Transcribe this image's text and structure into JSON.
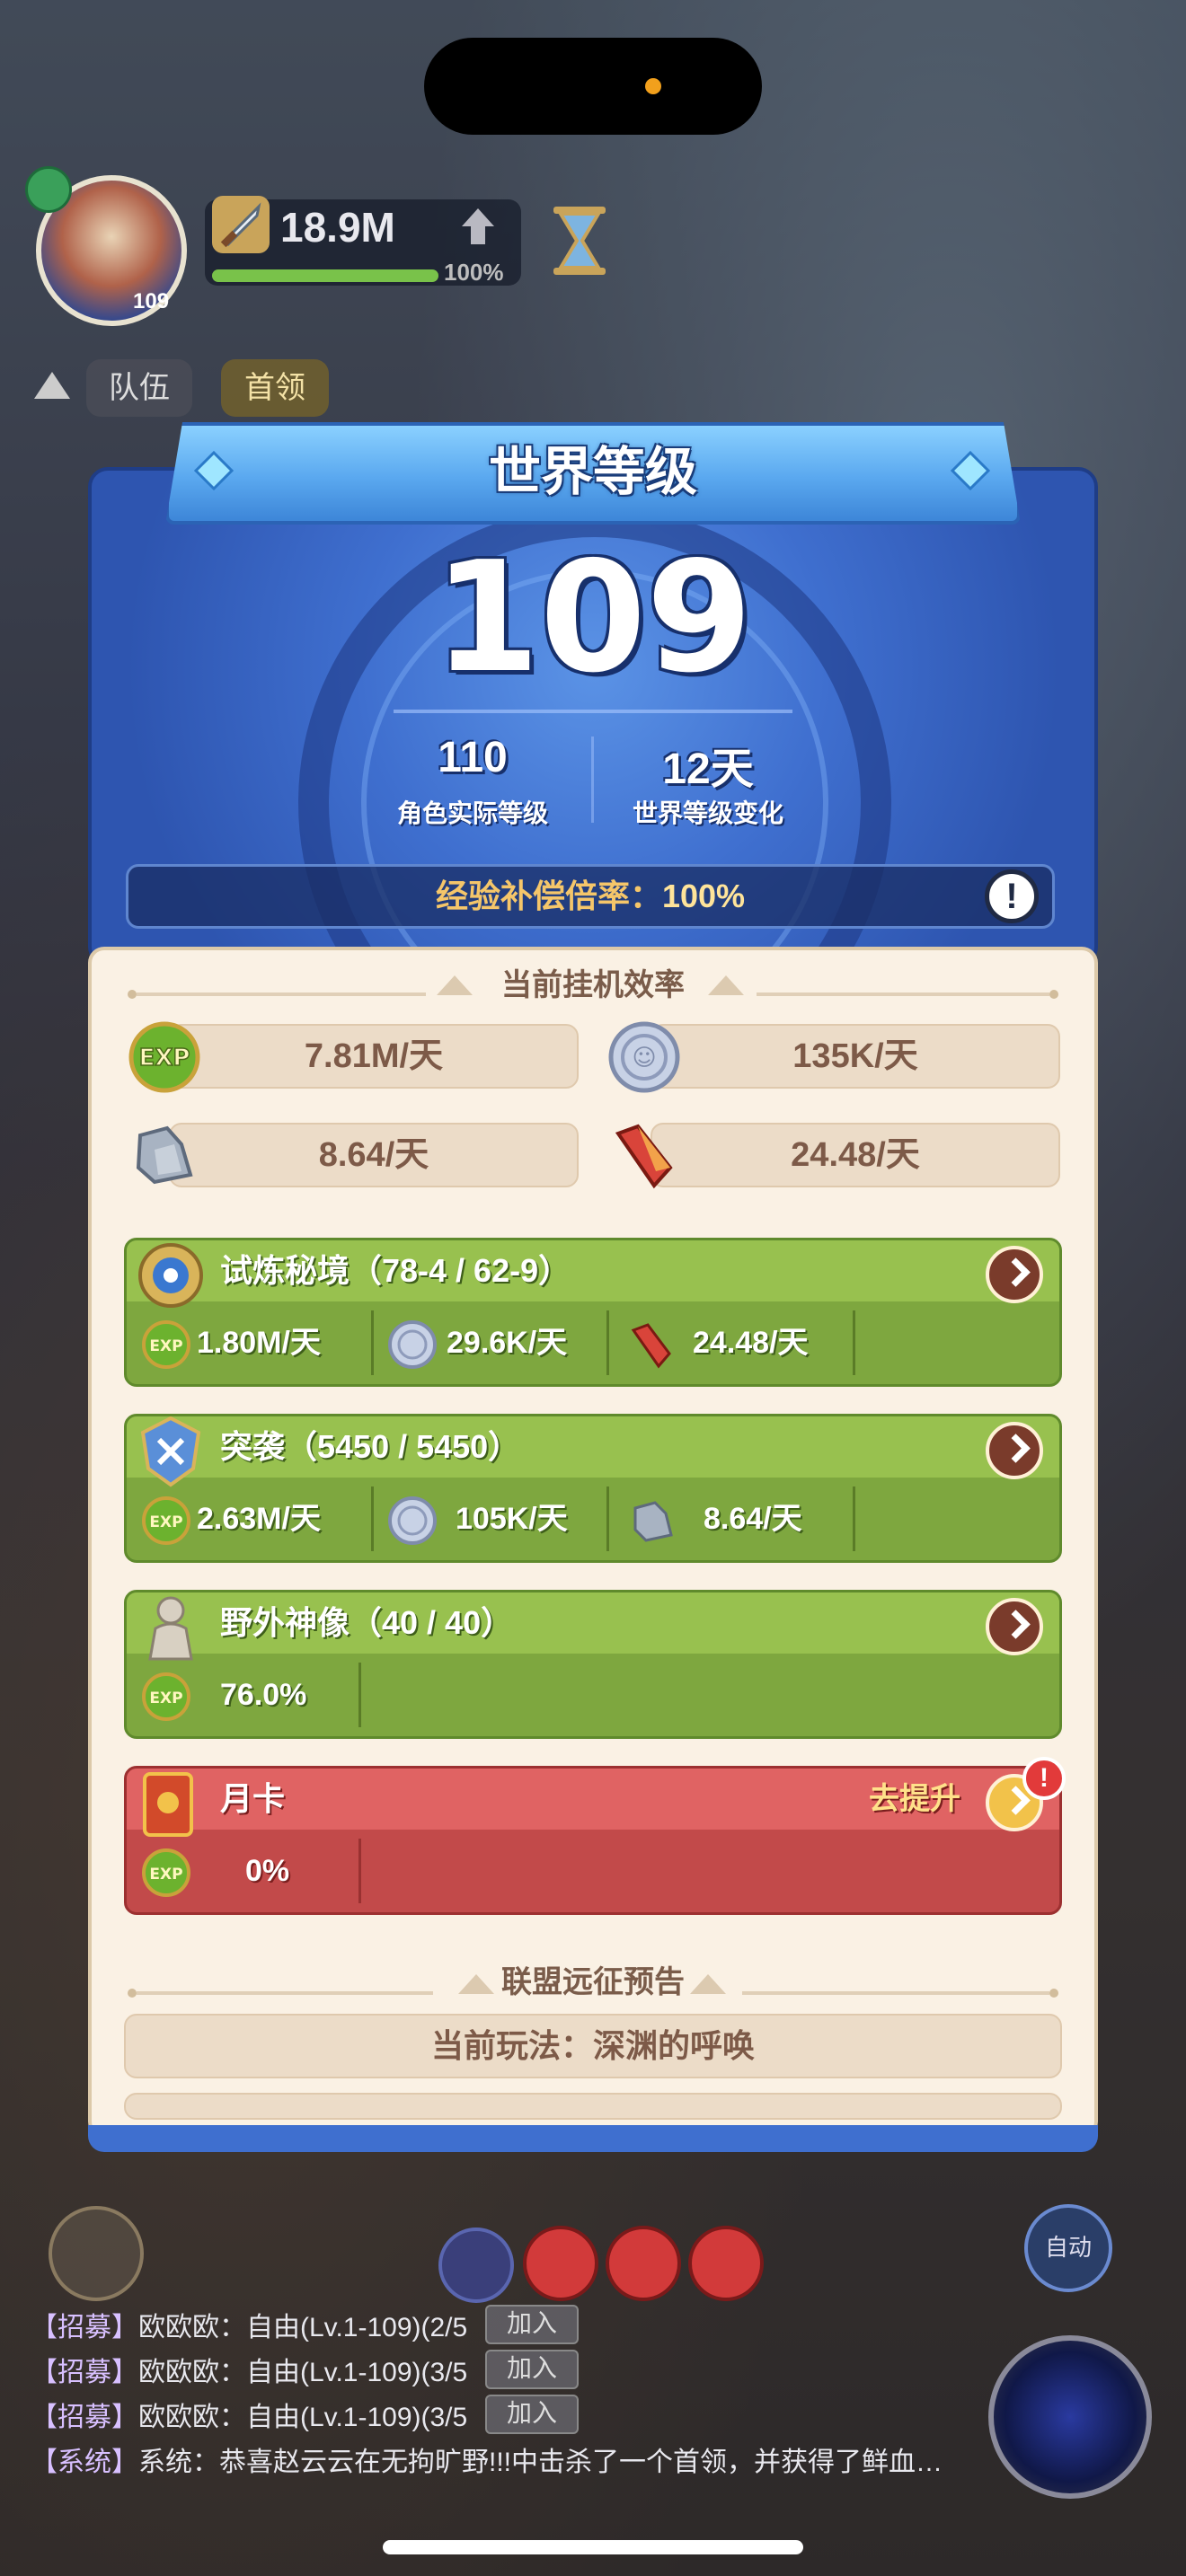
{
  "hud": {
    "avatar_level": "109",
    "power": "18.9M",
    "progress_pct": "100%",
    "progress_value": 100,
    "tabs": [
      "队伍",
      "首领"
    ]
  },
  "modal": {
    "title": "世界等级",
    "world_level": "109",
    "actual_level": "110",
    "actual_level_label": "角色实际等级",
    "change_days": "12天",
    "change_label": "世界等级变化",
    "exp_rate_label": "经验补偿倍率：",
    "exp_rate_value": "100%",
    "info_icon": "!"
  },
  "efficiency": {
    "heading": "当前挂机效率",
    "exp": "7.81M/天",
    "coin": "135K/天",
    "ore": "8.64/天",
    "crystal": "24.48/天"
  },
  "sources": [
    {
      "title": "试炼秘境（78-4 / 62-9）",
      "items": [
        "1.80M/天",
        "29.6K/天",
        "24.48/天"
      ]
    },
    {
      "title": "突袭（5450 / 5450）",
      "items": [
        "2.63M/天",
        "105K/天",
        "8.64/天"
      ]
    },
    {
      "title": "野外神像（40 / 40）",
      "items": [
        "76.0%"
      ]
    },
    {
      "title": "月卡",
      "promote": "去提升",
      "items": [
        "0%"
      ]
    }
  ],
  "alliance": {
    "heading": "联盟远征预告",
    "current_mode": "当前玩法：深渊的呼唤"
  },
  "chat": [
    {
      "tag": "【招募】",
      "text": "欧欧欧：自由(Lv.1-109)(2/5",
      "join": "加入"
    },
    {
      "tag": "【招募】",
      "text": "欧欧欧：自由(Lv.1-109)(3/5",
      "join": "加入"
    },
    {
      "tag": "【招募】",
      "text": "欧欧欧：自由(Lv.1-109)(3/5",
      "join": "加入"
    },
    {
      "tag": "【系统】",
      "text": "系统：恭喜赵云云在无拘旷野!!!中击杀了一个首领，并获得了鲜血…"
    }
  ],
  "auto_label": "自动",
  "colors": {
    "modal_blue": "#3f6fcf",
    "green_card": "#7ea73f",
    "red_card": "#c24a4a",
    "gold_text": "#f5c66a",
    "cream": "#faf1e4"
  }
}
